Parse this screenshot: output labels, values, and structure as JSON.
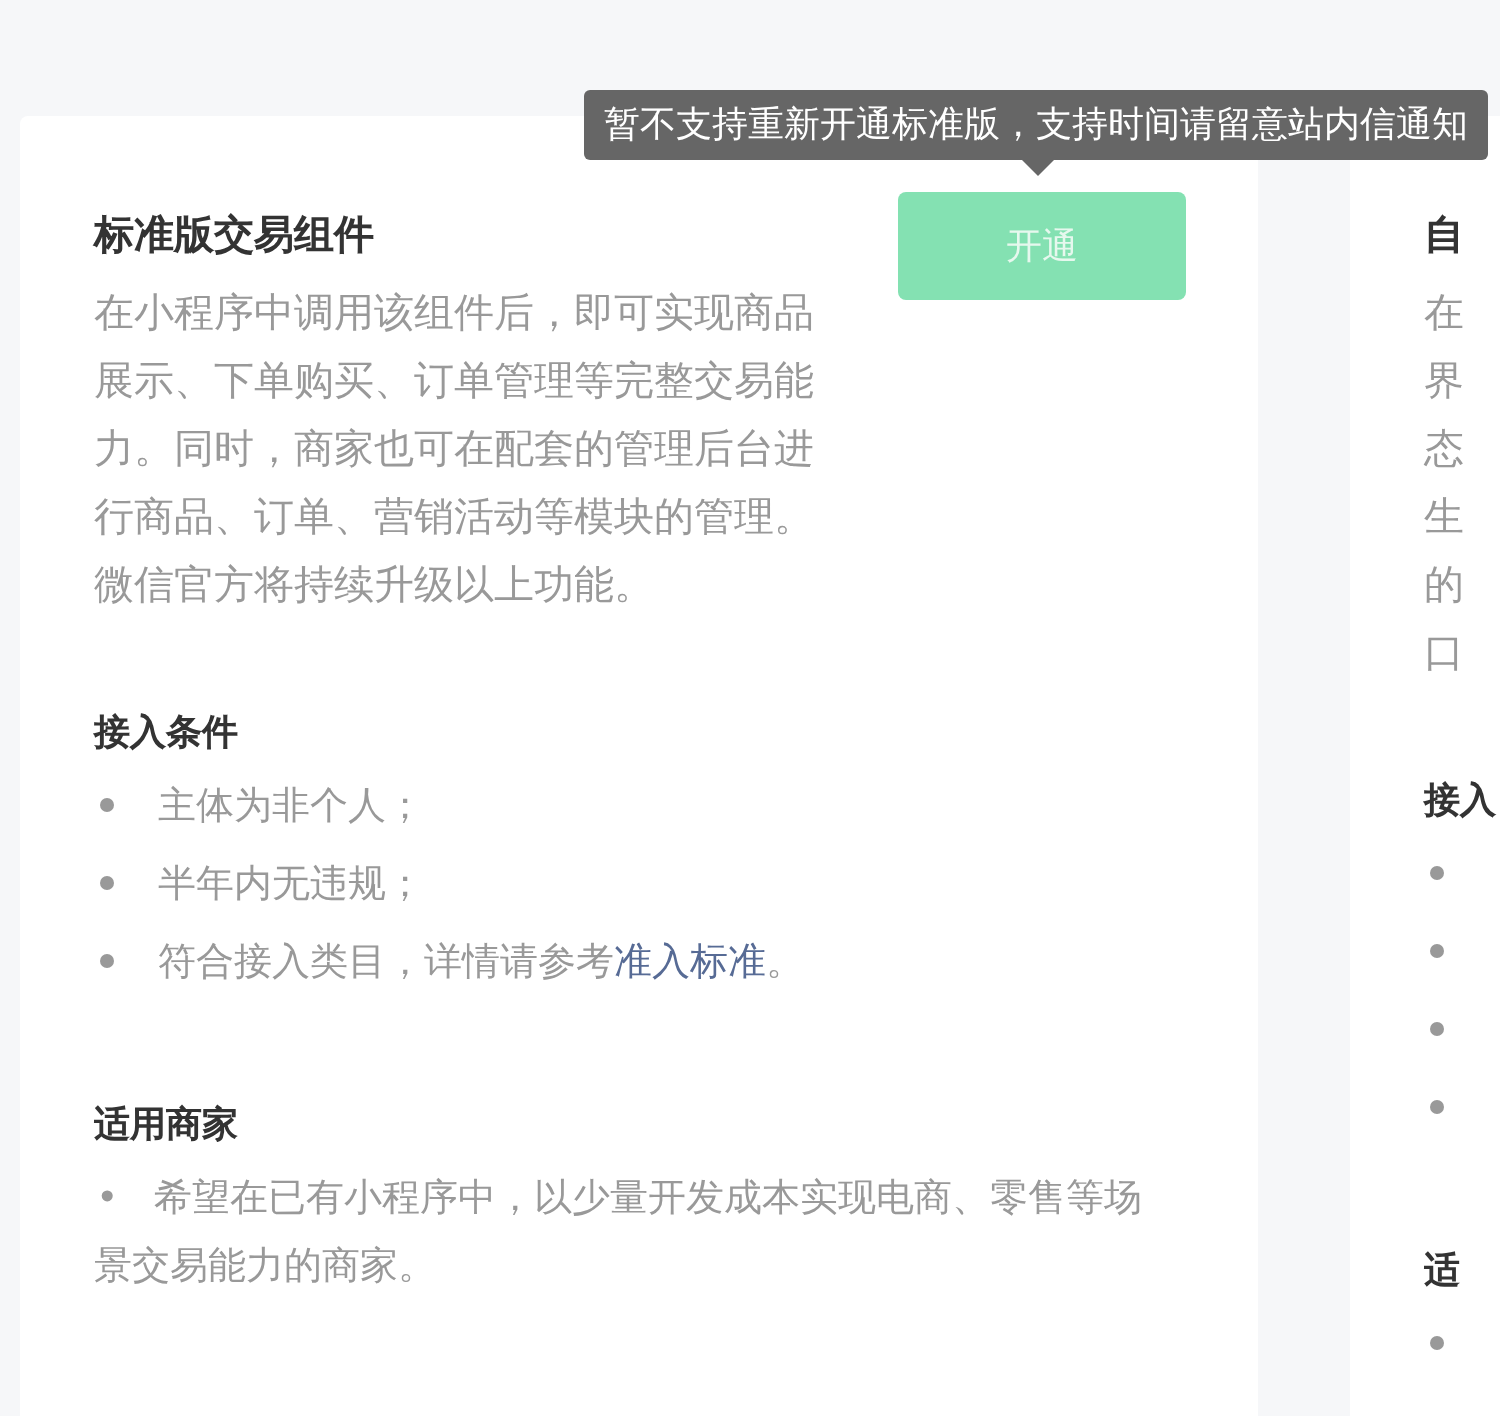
{
  "tooltip": {
    "text": "暂不支持重新开通标准版，支持时间请留意站内信通知"
  },
  "cards": [
    {
      "title": "标准版交易组件",
      "button": {
        "label": "开通",
        "disabled": true
      },
      "description": "在小程序中调用该组件后，即可实现商品展示、下单购买、订单管理等完整交易能力。同时，商家也可在配套的管理后台进行商品、订单、营销活动等模块的管理。微信官方将持续升级以上功能。",
      "sections": [
        {
          "heading": "接入条件",
          "items": [
            {
              "kind": "text",
              "text": "主体为非个人；"
            },
            {
              "kind": "text",
              "text": "半年内无违规；"
            },
            {
              "kind": "text",
              "text": "符合接入类目，详情请参考",
              "link": "准入标准",
              "tail": "。"
            }
          ]
        },
        {
          "heading": "适用商家",
          "items": [
            {
              "kind": "paragraph",
              "marker": "•",
              "text": "希望在已有小程序中，以少量开发成本实现电商、零售等场景交易能力的商家。"
            }
          ]
        }
      ]
    },
    {
      "title": "自",
      "description_lines": [
        "在",
        "界",
        "态",
        "生",
        "的",
        "口"
      ],
      "sections": [
        {
          "heading": "接入",
          "items": [
            {
              "kind": "bullet"
            },
            {
              "kind": "bullet"
            },
            {
              "kind": "bullet"
            },
            {
              "kind": "bullet"
            }
          ]
        },
        {
          "heading": "适",
          "items": [
            {
              "kind": "bullet"
            }
          ]
        }
      ]
    }
  ]
}
